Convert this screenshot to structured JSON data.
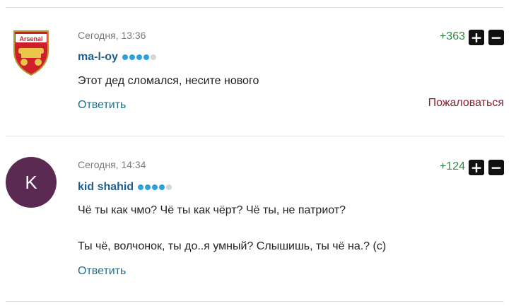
{
  "comments": [
    {
      "date": "Сегодня, 13:36",
      "user": "ma-l-oy",
      "rating_dots": {
        "filled": 4,
        "total": 5
      },
      "text": [
        "Этот дед сломался, несите нового"
      ],
      "score": "+363",
      "reply_label": "Ответить",
      "report_label": "Пожаловаться",
      "avatar": {
        "type": "logo",
        "name": "arsenal-logo",
        "text": "Arsenal"
      }
    },
    {
      "date": "Сегодня, 14:34",
      "user": "kid shahid",
      "rating_dots": {
        "filled": 4,
        "total": 5
      },
      "text": [
        "Чё ты как чмо? Чё ты как чёрт? Чё ты, не патриот?",
        "Ты чё, волчонок, ты до..я умный? Слышишь, ты чё на.? (с)"
      ],
      "score": "+124",
      "reply_label": "Ответить",
      "avatar": {
        "type": "letter",
        "letter": "K",
        "color": "#5b2a52"
      }
    }
  ],
  "vote": {
    "plus_symbol": "+",
    "minus_symbol": "−"
  }
}
